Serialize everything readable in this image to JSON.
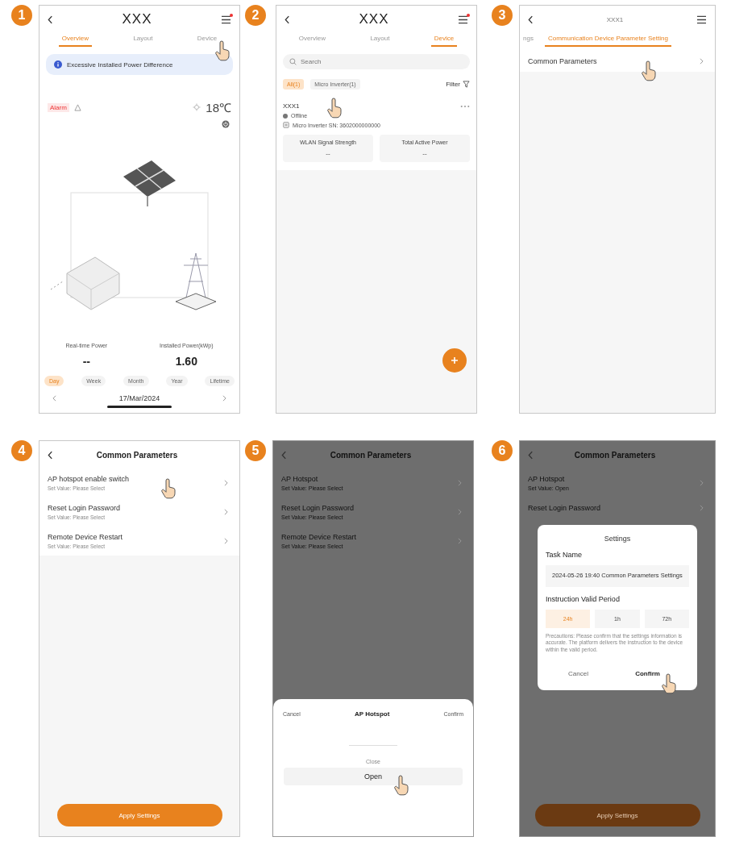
{
  "steps": [
    {
      "number": "1",
      "kind": "overview",
      "screen": {
        "title": "XXX",
        "menu_dot": true,
        "tabs": [
          {
            "label": "Overview",
            "selected": true,
            "tapped": false
          },
          {
            "label": "Layout",
            "selected": false,
            "tapped": false
          },
          {
            "label": "Device",
            "selected": false,
            "tapped": true
          }
        ],
        "notice": "Excessive Installed Power Difference",
        "alarm": "Alarm",
        "temperature": "18℃",
        "stats": [
          {
            "label": "Real-time Power",
            "value": "--"
          },
          {
            "label": "Installed Power(kWp)",
            "value": "1.60"
          }
        ],
        "periods": [
          {
            "label": "Day",
            "selected": true
          },
          {
            "label": "Week",
            "selected": false
          },
          {
            "label": "Month",
            "selected": false
          },
          {
            "label": "Year",
            "selected": false
          },
          {
            "label": "Lifetime",
            "selected": false
          }
        ],
        "date": "17/Mar/2024"
      }
    },
    {
      "number": "2",
      "kind": "device_list",
      "screen": {
        "title": "XXX",
        "menu_dot": true,
        "tabs": [
          {
            "label": "Overview",
            "selected": false,
            "tapped": false
          },
          {
            "label": "Layout",
            "selected": false,
            "tapped": false
          },
          {
            "label": "Device",
            "selected": true,
            "tapped": false
          }
        ],
        "search": {
          "placeholder": "Search"
        },
        "filters": [
          {
            "label": "All(1)",
            "selected": true
          },
          {
            "label": "Micro Inverter(1)",
            "selected": false
          }
        ],
        "filter_label": "Filter",
        "device": {
          "name": "XXX1",
          "status": "Offline",
          "sn": "Micro Inverter SN: 3602000000000",
          "tapped": true,
          "metrics": [
            {
              "label": "WLAN Signal Strength",
              "value": "--"
            },
            {
              "label": "Total Active Power",
              "value": "--"
            }
          ]
        }
      }
    },
    {
      "number": "3",
      "kind": "parameter_settings",
      "screen": {
        "title": "XXX1",
        "menu_dot": false,
        "tabs": [
          {
            "label": "ngs",
            "selected": false,
            "tapped": false
          },
          {
            "label": "Communication Device Parameter Setting",
            "selected": true,
            "tapped": false
          }
        ],
        "rows": [
          {
            "title": "Common Parameters",
            "tapped": true
          }
        ]
      }
    },
    {
      "number": "4",
      "kind": "parameter_list",
      "screen": {
        "title": "Common Parameters",
        "dimmed": false,
        "rows": [
          {
            "title": "AP hotspot enable switch",
            "value": "Set Value: Please Select",
            "tapped": true
          },
          {
            "title": "Reset Login Password",
            "value": "Set Value: Please Select",
            "tapped": false
          },
          {
            "title": "Remote Device Restart",
            "value": "Set Value: Please Select",
            "tapped": false
          }
        ],
        "apply": "Apply Settings"
      }
    },
    {
      "number": "5",
      "kind": "picker",
      "screen": {
        "title": "Common Parameters",
        "dimmed": true,
        "rows": [
          {
            "title": "AP Hotspot",
            "value": "Set Value: Please Select",
            "tapped": false
          },
          {
            "title": "Reset Login Password",
            "value": "Set Value: Please Select",
            "tapped": false
          },
          {
            "title": "Remote Device Restart",
            "value": "Set Value: Please Select",
            "tapped": false
          }
        ],
        "sheet": {
          "cancel": "Cancel",
          "title": "AP Hotspot",
          "confirm": "Confirm",
          "options": [
            {
              "label": "Close",
              "selected": false,
              "tapped": false
            },
            {
              "label": "Open",
              "selected": true,
              "tapped": true
            }
          ]
        }
      }
    },
    {
      "number": "6",
      "kind": "confirm_dialog",
      "screen": {
        "title": "Common Parameters",
        "dimmed": true,
        "rows": [
          {
            "title": "AP Hotspot",
            "value": "Set Value: Open",
            "tapped": false
          },
          {
            "title": "Reset Login Password",
            "tapped": false
          }
        ],
        "apply": "Apply Settings",
        "dialog": {
          "title": "Settings",
          "task_label": "Task Name",
          "task_value": "2024-05-26 19:40 Common Parameters Settings",
          "period_label": "Instruction Valid Period",
          "periods": [
            {
              "label": "24h",
              "selected": true
            },
            {
              "label": "1h",
              "selected": false
            },
            {
              "label": "72h",
              "selected": false
            }
          ],
          "note": "Precautions: Please confirm that the settings information is accurate. The platform delivers the instruction to the device within the valid period.",
          "cancel": "Cancel",
          "confirm": "Confirm",
          "confirm_tapped": true
        }
      }
    }
  ]
}
